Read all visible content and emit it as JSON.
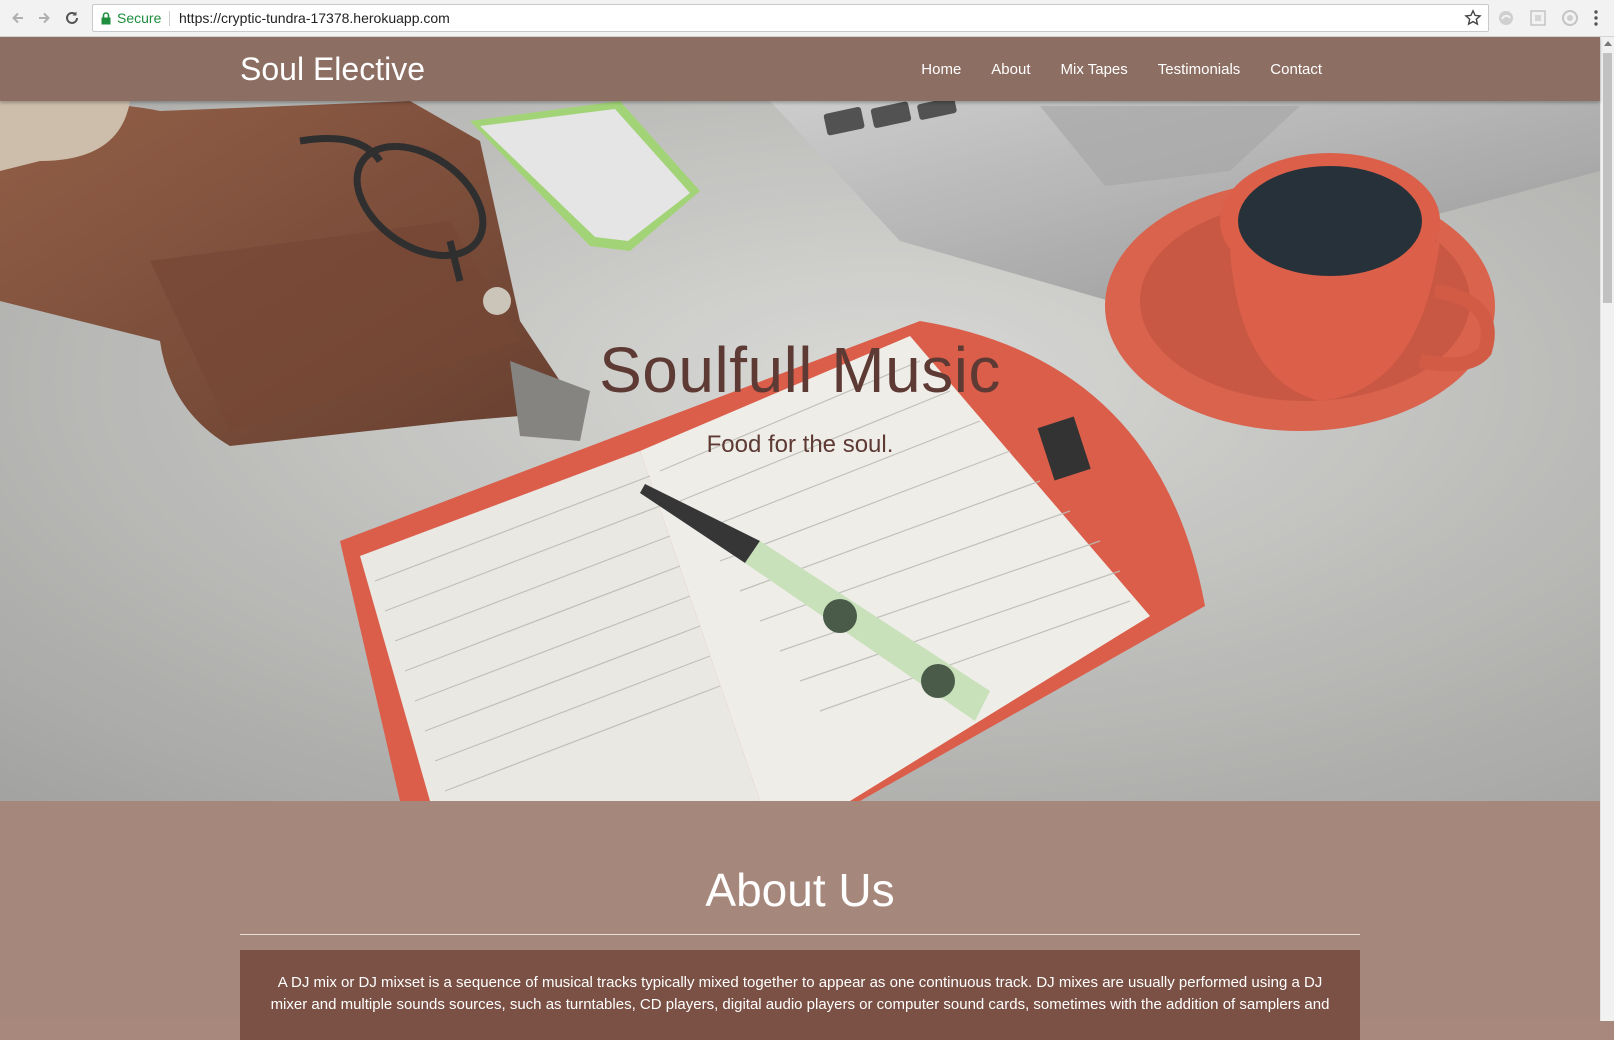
{
  "browser": {
    "secure_label": "Secure",
    "url": "https://cryptic-tundra-17378.herokuapp.com"
  },
  "site": {
    "brand": "Soul Elective",
    "nav": [
      {
        "label": "Home"
      },
      {
        "label": "About"
      },
      {
        "label": "Mix Tapes"
      },
      {
        "label": "Testimonials"
      },
      {
        "label": "Contact"
      }
    ]
  },
  "hero": {
    "title": "Soulfull Music",
    "subtitle": "Food for the soul."
  },
  "about": {
    "heading": "About Us",
    "body": "A DJ mix or DJ mixset is a sequence of musical tracks typically mixed together to appear as one continuous track. DJ mixes are usually performed using a DJ mixer and multiple sounds sources, such as turntables, CD players, digital audio players or computer sound cards, sometimes with the addition of samplers and"
  },
  "colors": {
    "navbar": "#8d6e63",
    "about_bg": "#a6877c",
    "card_bg": "#7b5145",
    "hero_text": "#5d3a34"
  }
}
